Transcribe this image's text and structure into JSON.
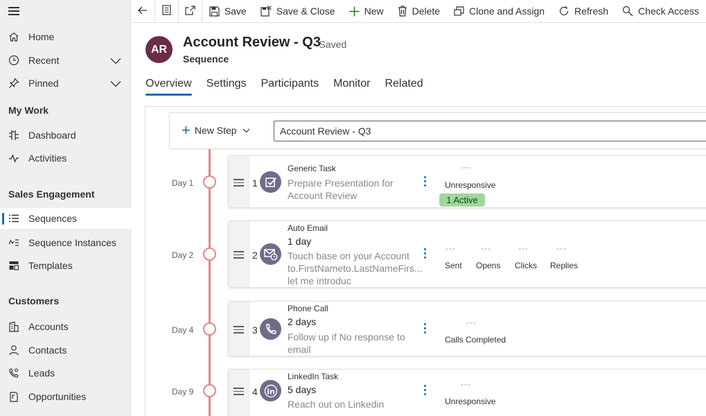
{
  "sidebar": {
    "menu_icon": "hamburger-icon",
    "items": {
      "home": "Home",
      "recent": "Recent",
      "pinned": "Pinned",
      "dashboard": "Dashboard",
      "activities": "Activities",
      "sequences": "Sequences",
      "sequence_instances": "Sequence Instances",
      "templates": "Templates",
      "accounts": "Accounts",
      "contacts": "Contacts",
      "leads": "Leads",
      "opportunities": "Opportunities"
    },
    "groups": {
      "my_work": "My Work",
      "sales_engagement": "Sales Engagement",
      "customers": "Customers"
    },
    "selected": "Sequences"
  },
  "commandbar": {
    "save": "Save",
    "save_close": "Save & Close",
    "new": "New",
    "delete": "Delete",
    "clone_assign": "Clone and Assign",
    "refresh": "Refresh",
    "check_access": "Check Access"
  },
  "header": {
    "avatar_initials": "AR",
    "avatar_color": "#6b2c4a",
    "title": "Account Review - Q3",
    "saved_status": "- Saved",
    "entity_type": "Sequence"
  },
  "tabs": [
    "Overview",
    "Settings",
    "Participants",
    "Monitor",
    "Related"
  ],
  "active_tab": "Overview",
  "designer": {
    "new_step_label": "New Step",
    "sequence_name": "Account Review - Q3",
    "steps": [
      {
        "day": "Day 1",
        "number": "1",
        "type": "Generic Task",
        "icon": "task-checkbox-icon",
        "delay": "",
        "description_line1": "Prepare Presentation for",
        "description_line2": "Account Review",
        "description_line3": "",
        "metric_dash": "---",
        "metric_label": "Unresponsive",
        "badge": "1 Active"
      },
      {
        "day": "Day 2",
        "number": "2",
        "type": "Auto Email",
        "icon": "email-clock-icon",
        "delay": "1 day",
        "description_line1": "Touch base on your Account",
        "description_line2": "to.FirstNameto.LastNameFirs...",
        "description_line3": "let me introduc",
        "metrics": [
          {
            "dash": "---",
            "label": "Sent"
          },
          {
            "dash": "---",
            "label": "Opens"
          },
          {
            "dash": "---",
            "label": "Clicks"
          },
          {
            "dash": "---",
            "label": "Replies"
          }
        ]
      },
      {
        "day": "Day 4",
        "number": "3",
        "type": "Phone Call",
        "icon": "phone-icon",
        "delay": "2 days",
        "description_line1": "Follow up if No response to",
        "description_line2": "email",
        "description_line3": "",
        "metric_dash": "---",
        "metric_label": "Calls Completed"
      },
      {
        "day": "Day 9",
        "number": "4",
        "type": "LinkedIn Task",
        "icon": "linkedin-icon",
        "delay": "5 days",
        "description_line1": "Reach out on Linkedin",
        "description_line2": "",
        "description_line3": "",
        "metric_dash": "---",
        "metric_label": "Unresponsive"
      }
    ]
  },
  "colors": {
    "accent": "#0f6cbd",
    "timeline": "#e3868a",
    "badge_bg": "#9fd89f",
    "step_icon_bg": "#6e6c8a"
  }
}
